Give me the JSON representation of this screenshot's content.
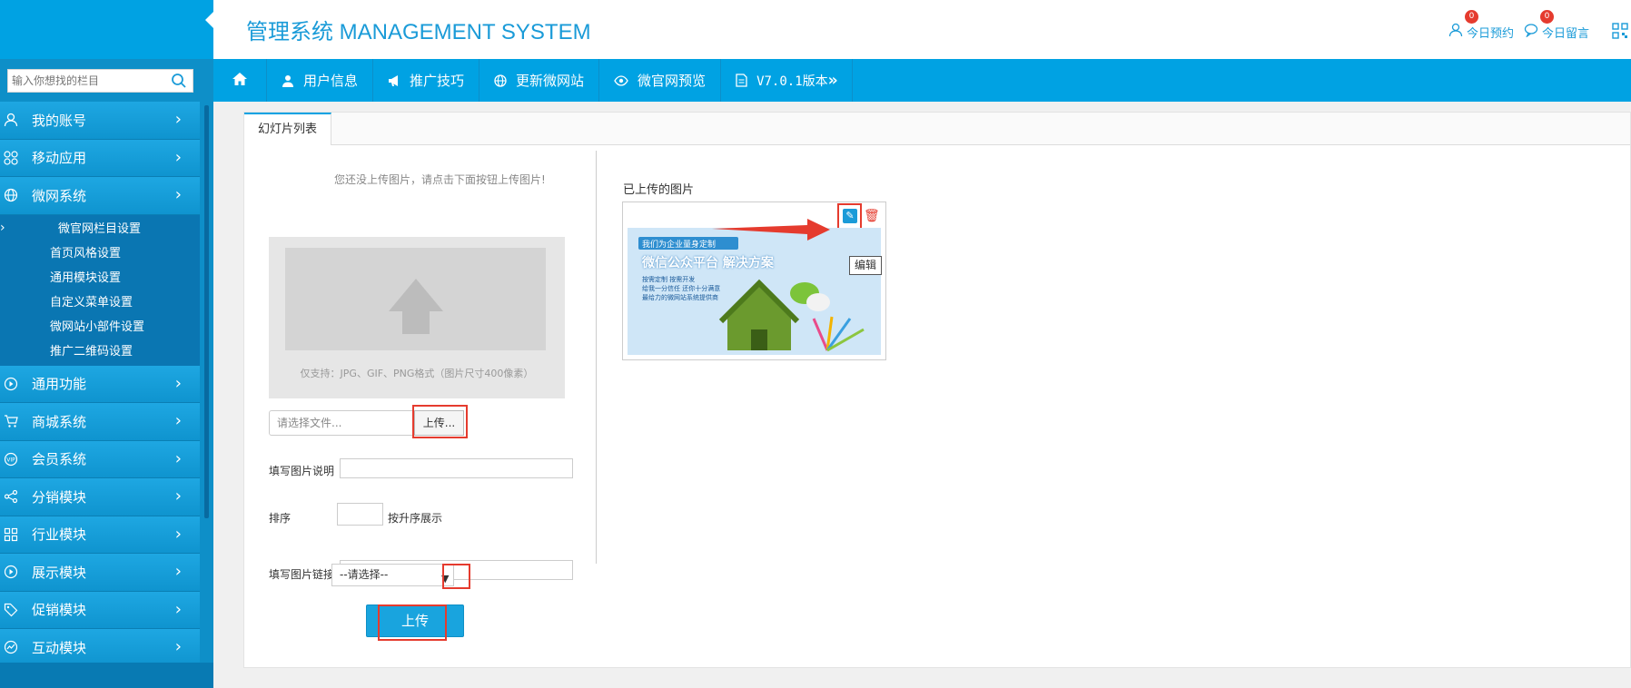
{
  "header": {
    "title": "管理系统 MANAGEMENT SYSTEM",
    "links": [
      {
        "label": "今日预约",
        "badge": "0",
        "icon": "user-icon"
      },
      {
        "label": "今日留言",
        "badge": "0",
        "icon": "chat-icon"
      }
    ]
  },
  "search": {
    "placeholder": "输入你想找的栏目"
  },
  "sidebar": {
    "items": [
      {
        "label": "我的账号",
        "icon": "user-icon"
      },
      {
        "label": "移动应用",
        "icon": "apps-icon"
      },
      {
        "label": "微网系统",
        "icon": "globe-icon"
      },
      {
        "label": "通用功能",
        "icon": "play-icon"
      },
      {
        "label": "商城系统",
        "icon": "cart-icon"
      },
      {
        "label": "会员系统",
        "icon": "vip-icon"
      },
      {
        "label": "分销模块",
        "icon": "share-icon"
      },
      {
        "label": "行业模块",
        "icon": "grid-icon"
      },
      {
        "label": "展示模块",
        "icon": "play-icon"
      },
      {
        "label": "促销模块",
        "icon": "tag-icon"
      },
      {
        "label": "互动模块",
        "icon": "chart-icon"
      }
    ],
    "sub_items": [
      "微官网栏目设置",
      "首页风格设置",
      "通用模块设置",
      "自定义菜单设置",
      "微网站小部件设置",
      "推广二维码设置"
    ]
  },
  "navbar": {
    "items": [
      {
        "label": "",
        "icon": "home-icon"
      },
      {
        "label": "用户信息",
        "icon": "user-icon"
      },
      {
        "label": "推广技巧",
        "icon": "megaphone-icon"
      },
      {
        "label": "更新微网站",
        "icon": "globe-icon"
      },
      {
        "label": "微官网预览",
        "icon": "eye-icon"
      },
      {
        "label": "V7.0.1版本",
        "icon": "document-icon"
      }
    ]
  },
  "tabs": {
    "active": "幻灯片列表"
  },
  "upload": {
    "hint": "您还没上传图片，请点击下面按钮上传图片!",
    "dropzone_text": "仅支持：JPG、GIF、PNG格式（图片尺寸400像素）",
    "file_placeholder": "请选择文件...",
    "upload_button": "上传...",
    "desc_label": "填写图片说明",
    "sort_label": "排序",
    "sort_hint": "按升序展示",
    "link_label": "填写图片链接",
    "select_default": "--请选择--",
    "submit": "上传"
  },
  "uploaded": {
    "label": "已上传的图片",
    "tooltip": "编辑",
    "image_text": {
      "line1": "我们为企业量身定制",
      "line2": "微信公众平台  解决方案",
      "line3": "按需定制  按需开发",
      "line4": "给我一分信任  还你十分满意",
      "line5": "最给力的微网站系统提供商"
    }
  },
  "colors": {
    "accent": "#00a2e3",
    "sidebar": "#0e8fc8",
    "highlight": "#e53b2e"
  }
}
